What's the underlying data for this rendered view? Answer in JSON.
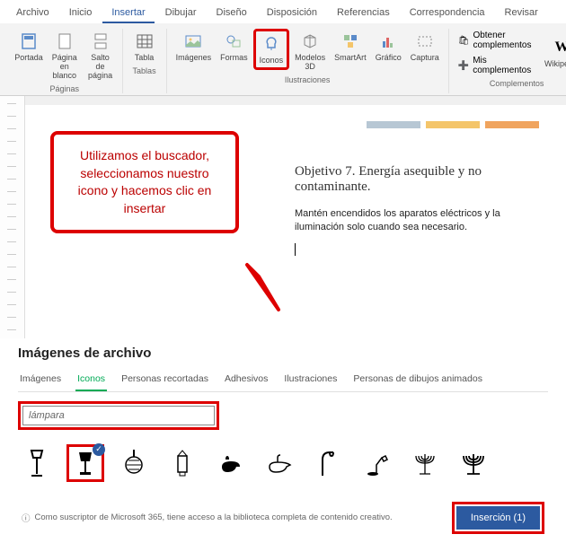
{
  "ribbon": {
    "tabs": [
      "Archivo",
      "Inicio",
      "Insertar",
      "Dibujar",
      "Diseño",
      "Disposición",
      "Referencias",
      "Correspondencia",
      "Revisar"
    ],
    "active_tab": "Insertar",
    "groups": {
      "paginas": {
        "label": "Páginas",
        "items": [
          {
            "label": "Portada"
          },
          {
            "label": "Página\nen blanco"
          },
          {
            "label": "Salto de\npágina"
          }
        ]
      },
      "tablas": {
        "label": "Tablas",
        "items": [
          {
            "label": "Tabla"
          }
        ]
      },
      "ilustraciones": {
        "label": "Ilustraciones",
        "items": [
          {
            "label": "Imágenes"
          },
          {
            "label": "Formas"
          },
          {
            "label": "Iconos"
          },
          {
            "label": "Modelos\n3D"
          },
          {
            "label": "SmartArt"
          },
          {
            "label": "Gráfico"
          },
          {
            "label": "Captura"
          }
        ]
      },
      "complementos": {
        "label": "Complementos",
        "side": [
          {
            "label": "Obtener complementos"
          },
          {
            "label": "Mis complementos"
          }
        ],
        "wiki": "Wikipedia"
      }
    }
  },
  "callout": {
    "text": "Utilizamos el buscador, seleccionamos nuestro icono y hacemos clic en insertar"
  },
  "document": {
    "heading": "Objetivo 7. Energía asequible y no contaminante.",
    "body": "Mantén encendidos los aparatos eléctricos y la iluminación solo cuando sea necesario.",
    "bar_colors": [
      "#b7c7d4",
      "#f4c56a",
      "#f0a45e"
    ]
  },
  "panel": {
    "title": "Imágenes de archivo",
    "tabs": [
      "Imágenes",
      "Iconos",
      "Personas recortadas",
      "Adhesivos",
      "Ilustraciones",
      "Personas de dibujos animados"
    ],
    "active_tab": "Iconos",
    "search_value": "lámpara",
    "footer_info": "Como suscriptor de Microsoft 365, tiene acceso a la biblioteca completa de contenido creativo.",
    "insert_label": "Inserción (1)"
  }
}
